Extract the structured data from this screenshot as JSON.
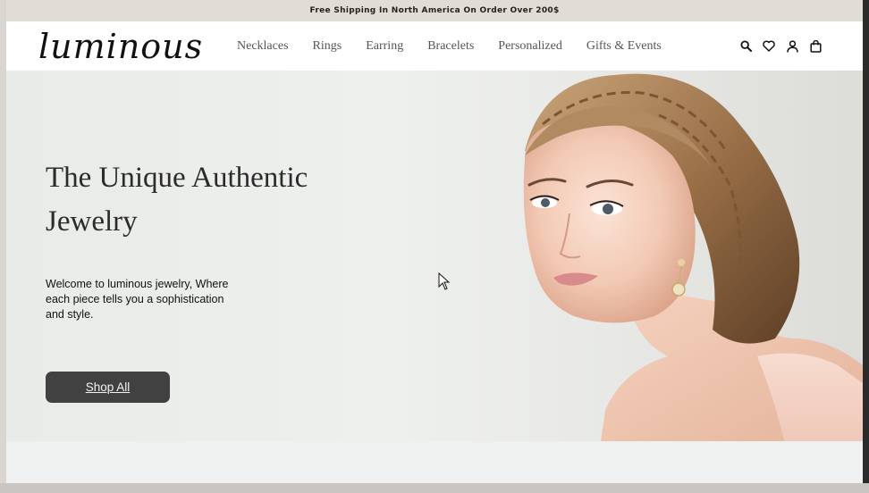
{
  "announcement": {
    "text": "Free Shipping In North America On Order Over 200$"
  },
  "brand": {
    "logo": "luminous"
  },
  "nav": {
    "items": [
      {
        "label": "Necklaces"
      },
      {
        "label": "Rings"
      },
      {
        "label": "Earring"
      },
      {
        "label": "Bracelets"
      },
      {
        "label": "Personalized"
      },
      {
        "label": "Gifts & Events"
      }
    ]
  },
  "header_icons": [
    "search-icon",
    "heart-icon",
    "user-icon",
    "bag-icon"
  ],
  "hero": {
    "title": "The Unique Authentic Jewelry",
    "subtitle": "Welcome to luminous jewelry, Where each piece tells you a sophistication and style.",
    "cta_label": "Shop All"
  },
  "colors": {
    "announcement_bg": "#e2dcd6",
    "button_bg": "#414141",
    "hero_bg": "#eef0ee"
  }
}
